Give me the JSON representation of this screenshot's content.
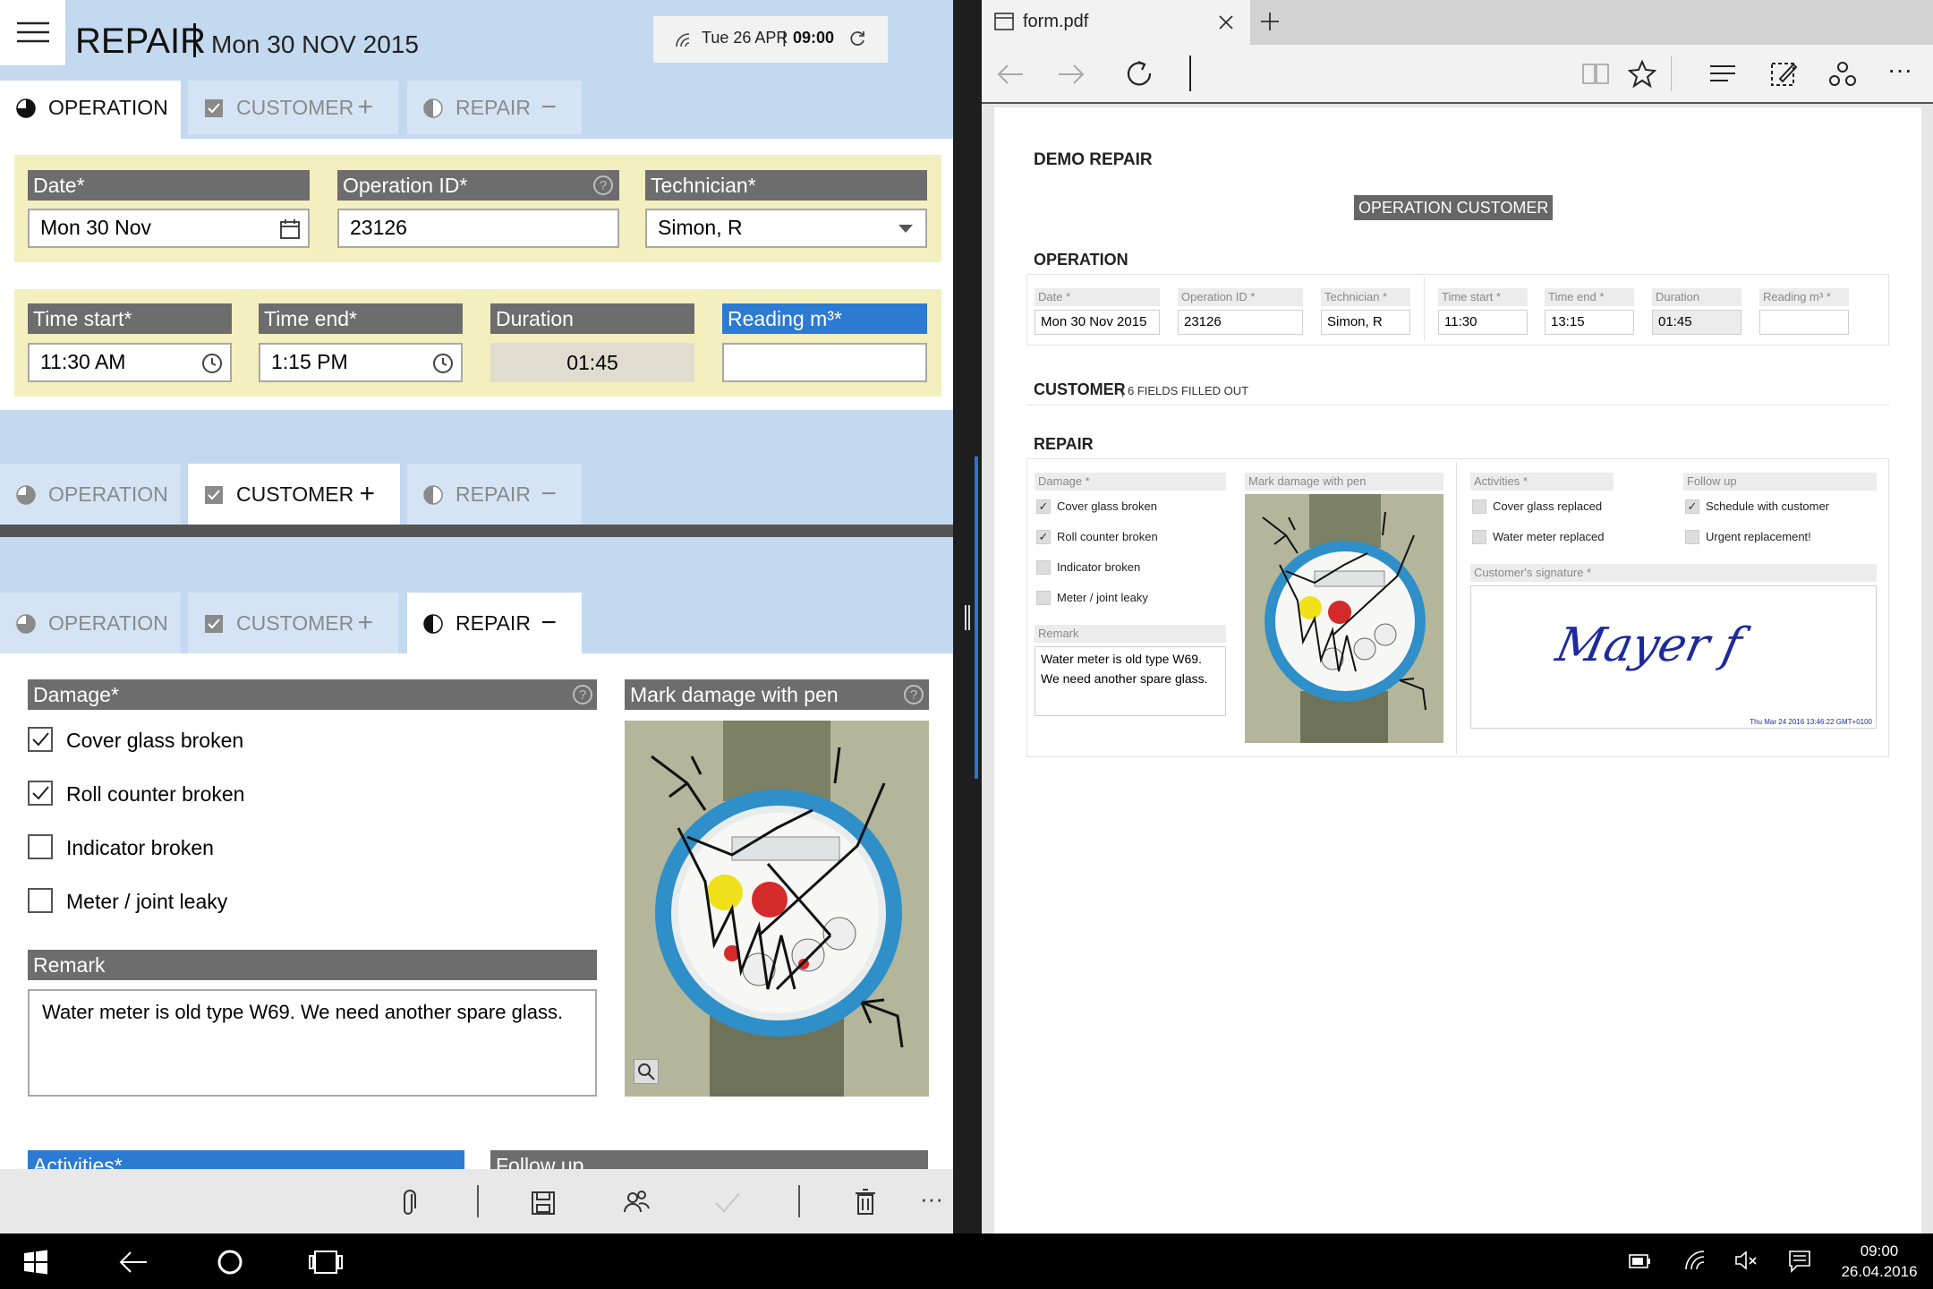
{
  "left_app": {
    "title": "REPAIR",
    "title_date": "Mon 30 NOV 2015",
    "status_date": "Tue 26 APR",
    "status_time": "09:00",
    "tabs": {
      "operation": "OPERATION",
      "customer": "CUSTOMER",
      "repair": "REPAIR"
    },
    "operation": {
      "date_label": "Date",
      "date_value": "Mon 30 Nov",
      "opid_label": "Operation ID",
      "opid_value": "23126",
      "tech_label": "Technician",
      "tech_value": "Simon, R",
      "tstart_label": "Time start",
      "tstart_value": "11:30 AM",
      "tend_label": "Time end",
      "tend_value": "1:15 PM",
      "duration_label": "Duration",
      "duration_value": "01:45",
      "reading_label": "Reading m³",
      "reading_value": "",
      "required_mark": "*"
    },
    "repair": {
      "damage_label": "Damage",
      "damage_items": [
        {
          "label": "Cover glass broken",
          "checked": true
        },
        {
          "label": "Roll counter broken",
          "checked": true
        },
        {
          "label": "Indicator broken",
          "checked": false
        },
        {
          "label": "Meter / joint leaky",
          "checked": false
        }
      ],
      "mark_label": "Mark damage with pen",
      "remark_label": "Remark",
      "remark_value": "Water meter is old type W69. We need another spare glass.",
      "activities_label": "Activities",
      "followup_label": "Follow up"
    }
  },
  "browser": {
    "tab_title": "form.pdf"
  },
  "pdf": {
    "title": "DEMO REPAIR",
    "banner": "OPERATION CUSTOMER",
    "operation_heading": "OPERATION",
    "labels": {
      "date": "Date *",
      "opid": "Operation ID *",
      "tech": "Technician *",
      "tstart": "Time start *",
      "tend": "Time end *",
      "duration": "Duration",
      "reading": "Reading m³ *"
    },
    "values": {
      "date": "Mon 30 Nov 2015",
      "opid": "23126",
      "tech": "Simon, R",
      "tstart": "11:30",
      "tend": "13:15",
      "duration": "01:45",
      "reading": ""
    },
    "customer_heading": "CUSTOMER",
    "customer_note": "| 6 FIELDS FILLED OUT",
    "repair_heading": "REPAIR",
    "damage_label": "Damage *",
    "damage_items": [
      {
        "label": "Cover glass broken",
        "checked": true
      },
      {
        "label": "Roll counter broken",
        "checked": true
      },
      {
        "label": "Indicator broken",
        "checked": false
      },
      {
        "label": "Meter / joint leaky",
        "checked": false
      }
    ],
    "remark_label": "Remark",
    "remark_value": "Water meter is old type W69. We need another spare glass.",
    "mark_label": "Mark damage with pen",
    "activities_label": "Activities *",
    "activities_items": [
      {
        "label": "Cover glass replaced",
        "checked": false
      },
      {
        "label": "Water meter replaced",
        "checked": false
      }
    ],
    "followup_label": "Follow up",
    "followup_items": [
      {
        "label": "Schedule with customer",
        "checked": true
      },
      {
        "label": "Urgent replacement!",
        "checked": false
      }
    ],
    "signature_label": "Customer's signature *",
    "signature_text": "Mayer f",
    "signature_timestamp": "Thu Mar 24 2016 13:46:22 GMT+0100"
  },
  "taskbar": {
    "time": "09:00",
    "date": "26.04.2016"
  }
}
